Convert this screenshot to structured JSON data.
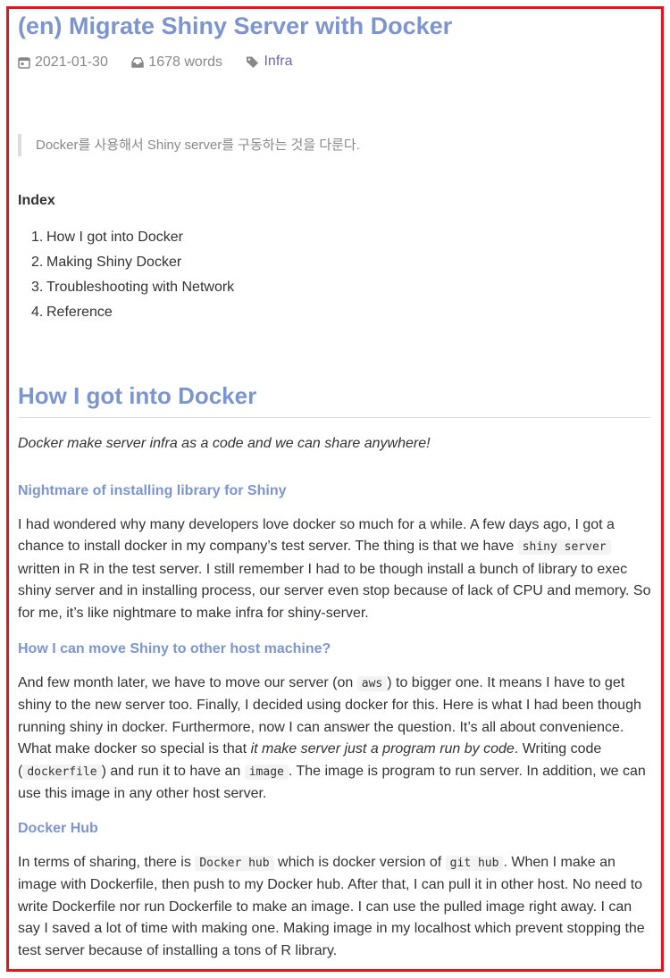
{
  "post": {
    "title": "(en) Migrate Shiny Server with Docker",
    "date": "2021-01-30",
    "words": "1678 words",
    "tag": "Infra",
    "summary": "Docker를 사용해서 Shiny server를 구동하는 것을 다룬다."
  },
  "index": {
    "heading": "Index",
    "items": [
      {
        "num": "1.",
        "label": "How I got into Docker"
      },
      {
        "num": "2.",
        "label": "Making Shiny Docker"
      },
      {
        "num": "3.",
        "label": "Troubleshooting with Network"
      },
      {
        "num": "4.",
        "label": "Reference"
      }
    ]
  },
  "section1": {
    "heading": "How I got into Docker",
    "lead": "Docker make server infra as a code and we can share anywhere!",
    "sub1": {
      "heading": "Nightmare of installing library for Shiny",
      "p1": "I had wondered why many developers love docker so much for a while. A few days ago, I got a chance to install docker in my company’s test server. The thing is that we have ",
      "code1": "shiny server",
      "p2": " written in R in the test server. I still remember I had to be though install a bunch of library to exec shiny server and in installing process, our server even stop because of lack of CPU and memory. So for me, it’s like nightmare to make infra for shiny-server."
    },
    "sub2": {
      "heading": "How I can move Shiny to other host machine?",
      "p1": "And few month later, we have to move our server (on ",
      "code1": "aws",
      "p2": ") to bigger one. It means I have to get shiny to the new server too. Finally, I decided using docker for this. Here is what I had been though running shiny in docker. Furthermore, now I can answer the question. It’s all about convenience. What make docker so special is that ",
      "em1": "it make server just a program run by code",
      "p3": ". Writing code (",
      "code2": "dockerfile",
      "p4": ") and run it to have an ",
      "code3": "image",
      "p5": ". The image is program to run server. In addition, we can use this image in any other host server."
    },
    "sub3": {
      "heading": "Docker Hub",
      "p1": "In terms of sharing, there is ",
      "code1": "Docker hub",
      "p2": " which is docker version of ",
      "code2": "git hub",
      "p3": ". When I make an image with Dockerfile, then push to my Docker hub. After that, I can pull it in other host. No need to write Dockerfile nor run Dockerfile to make an image. I can use the pulled image right away. I can say I saved a lot of time with making one. Making image in my localhost which prevent stopping the test server because of installing a tons of R library."
    }
  }
}
